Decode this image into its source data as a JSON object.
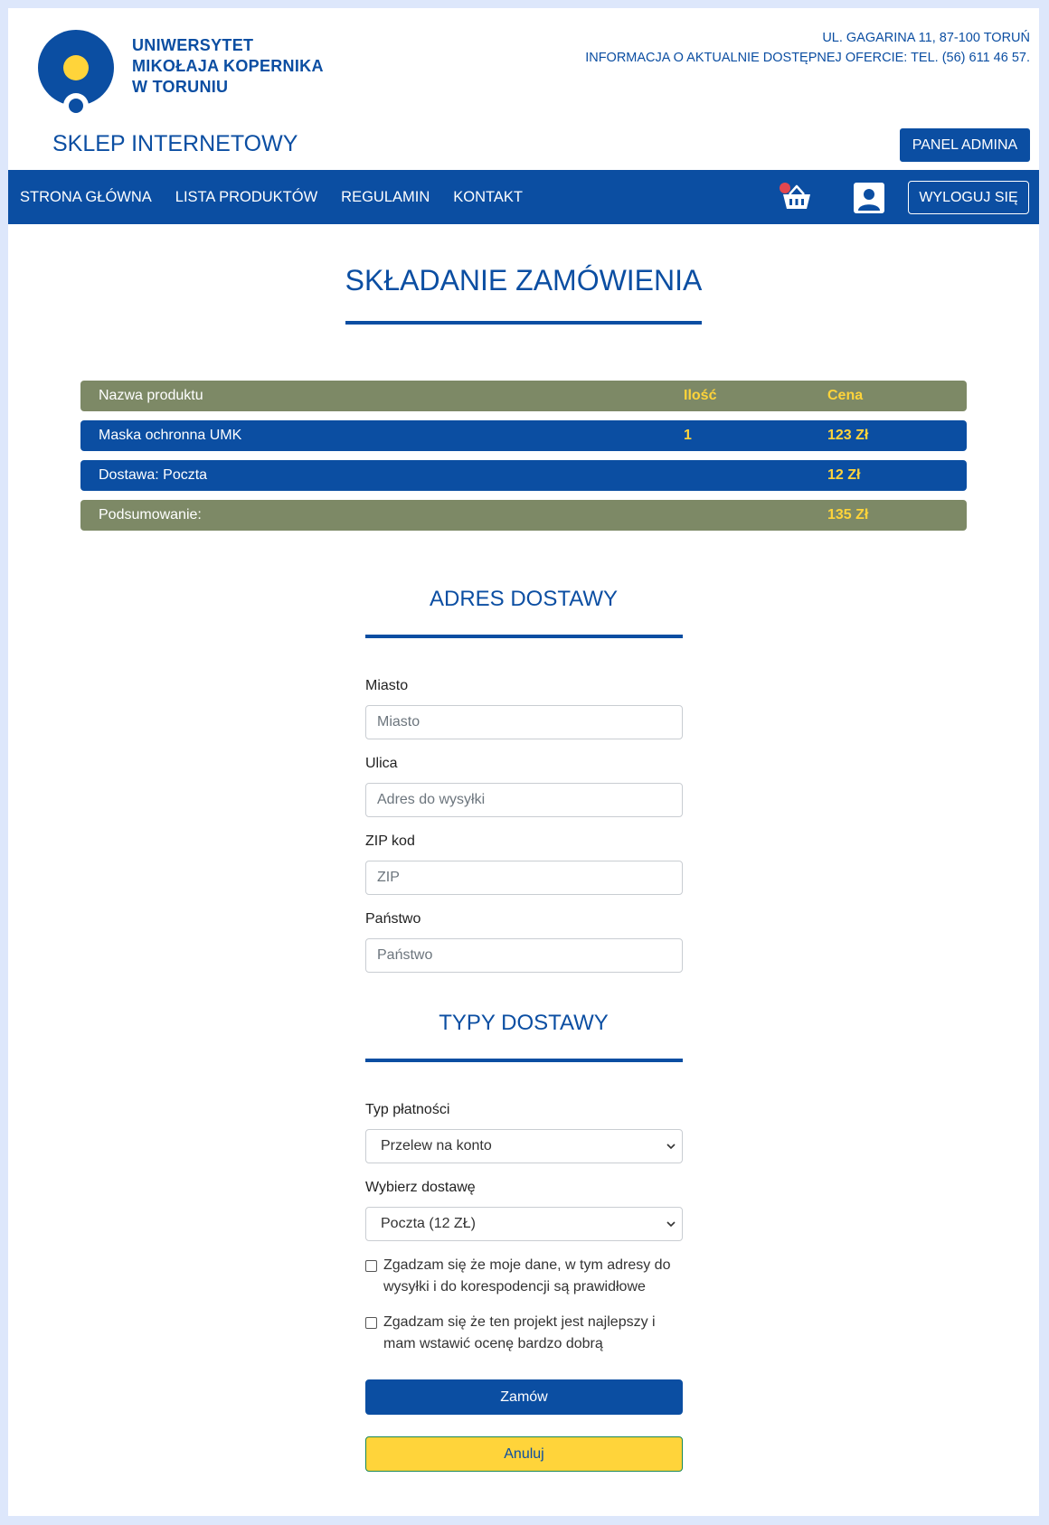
{
  "header": {
    "university": [
      "UNIWERSYTET",
      "MIKOŁAJA KOPERNIKA",
      "W TORUNIU"
    ],
    "address": "UL. GAGARINA 11, 87-100 TORUŃ",
    "info": "INFORMACJA O AKTUALNIE DOSTĘPNEJ OFERCIE: TEL. (56) 611 46 57.",
    "shop_title": "SKLEP INTERNETOWY",
    "admin_button": "PANEL ADMINA"
  },
  "nav": {
    "links": [
      "STRONA GŁÓWNA",
      "LISTA PRODUKTÓW",
      "REGULAMIN",
      "KONTAKT"
    ],
    "logout": "WYLOGUJ SIĘ"
  },
  "page_title": "SKŁADANIE ZAMÓWIENIA",
  "order_table": {
    "header": {
      "name": "Nazwa produktu",
      "qty": "Ilość",
      "price": "Cena"
    },
    "rows": [
      {
        "name": "Maska ochronna UMK",
        "qty": "1",
        "price": "123 Zł"
      },
      {
        "name": "Dostawa: Poczta",
        "qty": "",
        "price": "12 Zł"
      }
    ],
    "summary": {
      "name": "Podsumowanie:",
      "price": "135 Zł"
    }
  },
  "address_section": {
    "title": "ADRES DOSTAWY",
    "fields": [
      {
        "label": "Miasto",
        "placeholder": "Miasto",
        "value": ""
      },
      {
        "label": "Ulica",
        "placeholder": "Adres do wysyłki",
        "value": ""
      },
      {
        "label": "ZIP kod",
        "placeholder": "ZIP",
        "value": ""
      },
      {
        "label": "Państwo",
        "placeholder": "Państwo",
        "value": ""
      }
    ]
  },
  "delivery_section": {
    "title": "TYPY DOSTAWY",
    "payment_label": "Typ płatności",
    "payment_value": "Przelew na konto",
    "delivery_label": "Wybierz dostawę",
    "delivery_value": "Poczta (12 ZŁ)",
    "consent1": "Zgadzam się że moje dane, w tym adresy do wysyłki i do korespodencji są prawidłowe",
    "consent2": "Zgadzam się że ten projekt jest najlepszy i mam wstawić ocenę bardzo dobrą",
    "order_button": "Zamów",
    "cancel_button": "Anuluj"
  },
  "colors": {
    "primary": "#0b4ea2",
    "accent": "#ffd43a",
    "muted_row": "#7d8966",
    "badge": "#e2474f"
  },
  "icons": {
    "cart": "basket-icon",
    "user": "user-icon",
    "select": "chevron-down-icon"
  }
}
